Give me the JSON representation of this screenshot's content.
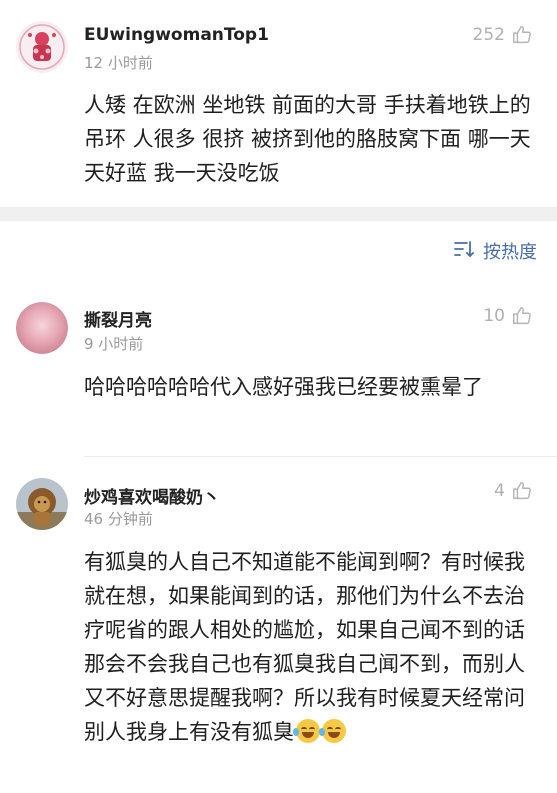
{
  "comments": [
    {
      "username": "EUwingwomanTop1",
      "time": "12 小时前",
      "likes": "252",
      "body": "人矮 在欧洲 坐地铁 前面的大哥 手扶着地铁上的吊环 人很多 很挤 被挤到他的胳肢窝下面 哪一天 天好蓝 我一天没吃饭",
      "avatar_icon": "cartoon-avatar-icon"
    },
    {
      "username": "撕裂月亮",
      "time": "9 小时前",
      "likes": "10",
      "body": "哈哈哈哈哈哈代入感好强我已经要被熏晕了",
      "avatar_icon": "pink-blur-avatar-icon"
    },
    {
      "username": "炒鸡喜欢喝酸奶丶",
      "time": "46 分钟前",
      "likes": "4",
      "body": "有狐臭的人自己不知道能不能闻到啊？有时候我就在想，如果能闻到的话，那他们为什么不去治疗呢省的跟人相处的尴尬，如果自己闻不到的话那会不会我自己也有狐臭我自己闻不到，而别人又不好意思提醒我啊？所以我有时候夏天经常问别人我身上有没有狐臭",
      "avatar_icon": "lion-avatar-icon"
    }
  ],
  "sort": {
    "label": "按热度",
    "icon": "sort-icon"
  },
  "colors": {
    "accent": "#4a6da7",
    "muted": "#9a9a9a",
    "band": "#f0f0f0"
  }
}
